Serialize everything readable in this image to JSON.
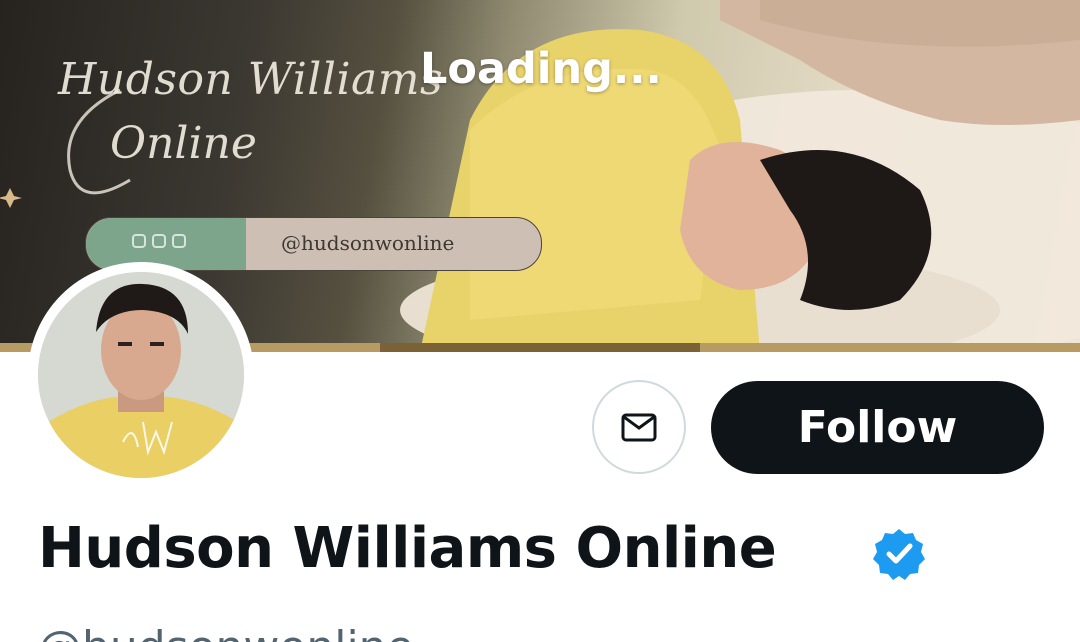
{
  "banner": {
    "brand_line1": "Hudson Williams",
    "brand_line2": "Online",
    "loading_text": "Loading...",
    "handle": "@hudsonwonline",
    "social_icons": [
      "twitter-icon",
      "instagram-icon",
      "threads-icon"
    ]
  },
  "avatar": {
    "monogram": "HW"
  },
  "actions": {
    "message_icon": "envelope-icon",
    "follow_label": "Follow"
  },
  "profile": {
    "display_name": "Hudson Williams Online",
    "verified_icon": "verified-badge-icon",
    "handle_partial": "@hudsonwonline"
  },
  "colors": {
    "follow_bg": "#0f1419",
    "verified_blue": "#1d9bf0",
    "banner_bar": "#b89a63",
    "pill_social": "#7ca58c"
  }
}
